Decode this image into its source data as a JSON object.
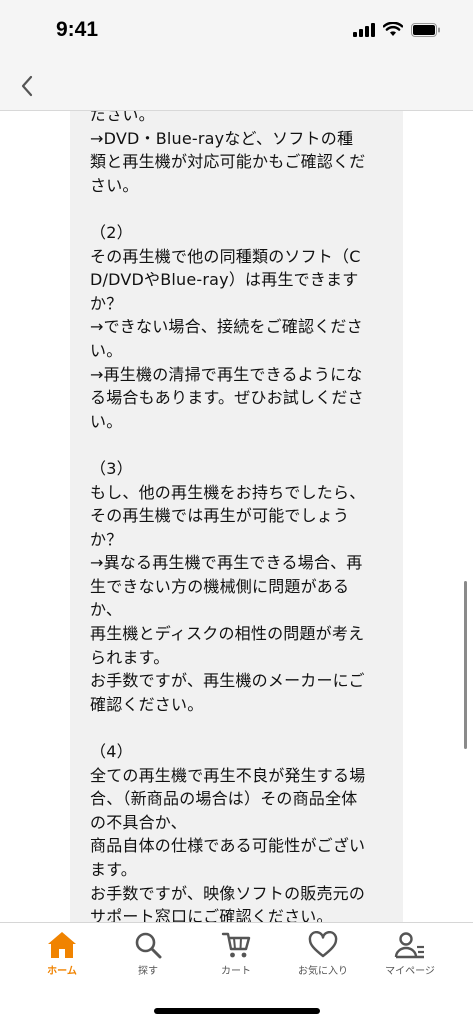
{
  "status": {
    "time": "9:41"
  },
  "colors": {
    "accent": "#f08300",
    "text_box_bg": "#f1f1f1",
    "icon_gray": "#555555"
  },
  "article": {
    "lines": [
      "ださい。",
      "→DVD・Blue-rayなど、ソフトの種",
      "類と再生機が対応可能かもご確認くだ",
      "さい。",
      "",
      "（2）",
      "その再生機で他の同種類のソフト（C",
      "D/DVDやBlue-ray）は再生できます",
      "か？",
      "→できない場合、接続をご確認くださ",
      "い。",
      "→再生機の清掃で再生できるようにな",
      "る場合もあります。ぜひお試しくださ",
      "い。",
      "",
      "（3）",
      "もし、他の再生機をお持ちでしたら、",
      "その再生機では再生が可能でしょう",
      "か？",
      "→異なる再生機で再生できる場合、再",
      "生できない方の機械側に問題がある",
      "か、",
      "再生機とディスクの相性の問題が考え",
      "られます。",
      "お手数ですが、再生機のメーカーにご",
      "確認ください。",
      "",
      "（4）",
      "全ての再生機で再生不良が発生する場",
      "合、（新商品の場合は）その商品全体",
      "の不具合か、",
      "商品自体の仕様である可能性がござい",
      "ます。",
      "お手数ですが、映像ソフトの販売元の",
      "サポート窓口にご確認ください。"
    ]
  },
  "tabbar": {
    "home": "ホーム",
    "search": "探す",
    "cart": "カート",
    "favorites": "お気に入り",
    "mypage": "マイページ"
  }
}
